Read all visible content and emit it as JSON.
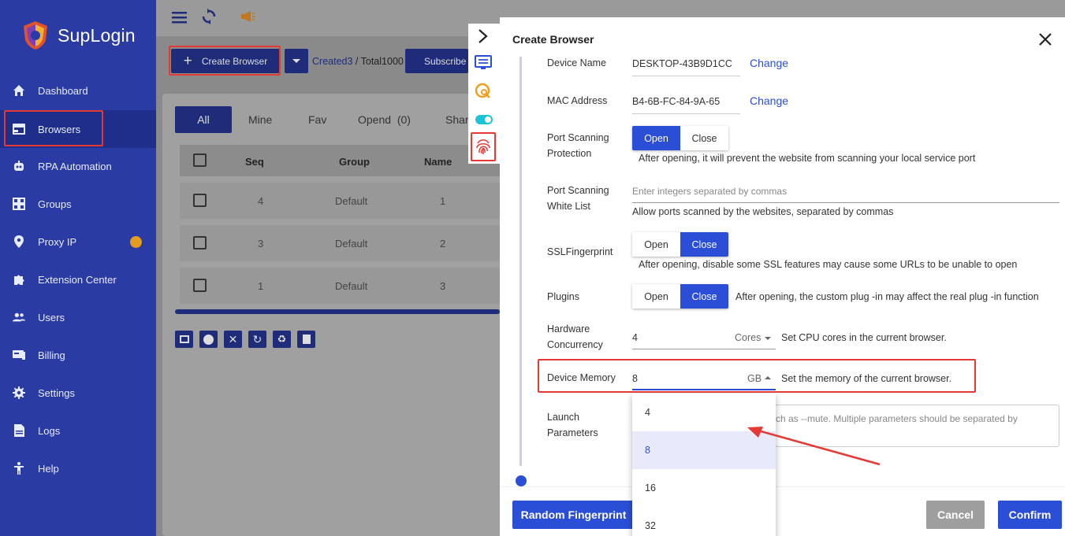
{
  "app": {
    "name": "SupLogin"
  },
  "sidebar": {
    "items": [
      {
        "label": "Dashboard",
        "icon": "home-icon"
      },
      {
        "label": "Browsers",
        "icon": "browser-icon",
        "active": true
      },
      {
        "label": "RPA Automation",
        "icon": "robot-icon"
      },
      {
        "label": "Groups",
        "icon": "grid-icon"
      },
      {
        "label": "Proxy IP",
        "icon": "location-icon"
      },
      {
        "label": "Extension Center",
        "icon": "puzzle-icon"
      },
      {
        "label": "Users",
        "icon": "users-icon"
      },
      {
        "label": "Billing",
        "icon": "billing-icon"
      },
      {
        "label": "Settings",
        "icon": "gear-icon"
      },
      {
        "label": "Logs",
        "icon": "document-icon"
      },
      {
        "label": "Help",
        "icon": "help-icon"
      }
    ]
  },
  "toolbar": {
    "create_label": "Create Browser",
    "created": "Created3",
    "total": " / Total1000",
    "subscribe_label": "Subscribe"
  },
  "tabs": {
    "all": "All",
    "mine": "Mine",
    "fav": "Fav",
    "opend": "Opend",
    "opend_count": "(0)",
    "share": "Shar"
  },
  "table": {
    "headers": {
      "seq": "Seq",
      "group": "Group",
      "name": "Name"
    },
    "rows": [
      {
        "seq": "4",
        "group": "Default",
        "name": "1"
      },
      {
        "seq": "3",
        "group": "Default",
        "name": "2"
      },
      {
        "seq": "1",
        "group": "Default",
        "name": "3"
      }
    ]
  },
  "dialog": {
    "title": "Create Browser",
    "device_name": {
      "label": "Device Name",
      "value": "DESKTOP-43B9D1CC",
      "change": "Change"
    },
    "mac_address": {
      "label": "MAC Address",
      "value": "B4-6B-FC-84-9A-65",
      "change": "Change"
    },
    "port_scan_protection": {
      "label_1": "Port Scanning",
      "label_2": "Protection",
      "open": "Open",
      "close": "Close",
      "selected": "Open",
      "hint": "After opening, it will prevent the website from scanning your local service port"
    },
    "port_scan_whitelist": {
      "label_1": "Port Scanning",
      "label_2": "White List",
      "placeholder": "Enter integers separated by commas",
      "hint": "Allow ports scanned by the websites, separated by commas"
    },
    "ssl_fingerprint": {
      "label": "SSLFingerprint",
      "open": "Open",
      "close": "Close",
      "selected": "Close",
      "hint": "After opening, disable some SSL features may cause some URLs to be unable to open"
    },
    "plugins": {
      "label": "Plugins",
      "open": "Open",
      "close": "Close",
      "selected": "Close",
      "hint": "After opening, the custom plug -in may affect the real plug -in function"
    },
    "hardware_concurrency": {
      "label_1": "Hardware",
      "label_2": "Concurrency",
      "value": "4",
      "unit": "Cores",
      "hint": "Set CPU cores in the current browser."
    },
    "device_memory": {
      "label": "Device Memory",
      "value": "8",
      "unit": "GB",
      "hint": "Set the memory of the current browser.",
      "options": [
        "4",
        "8",
        "16",
        "32"
      ],
      "selected": "8"
    },
    "launch_params": {
      "label_1": "Launch",
      "label_2": "Parameters",
      "placeholder": "ch as --mute. Multiple parameters should be separated by"
    },
    "random_fp_label": "Random Fingerprint",
    "cancel_label": "Cancel",
    "confirm_label": "Confirm"
  },
  "colors": {
    "sidebar": "#2a3ba3",
    "accent": "#2b4ed6",
    "highlight": "#e53935"
  }
}
